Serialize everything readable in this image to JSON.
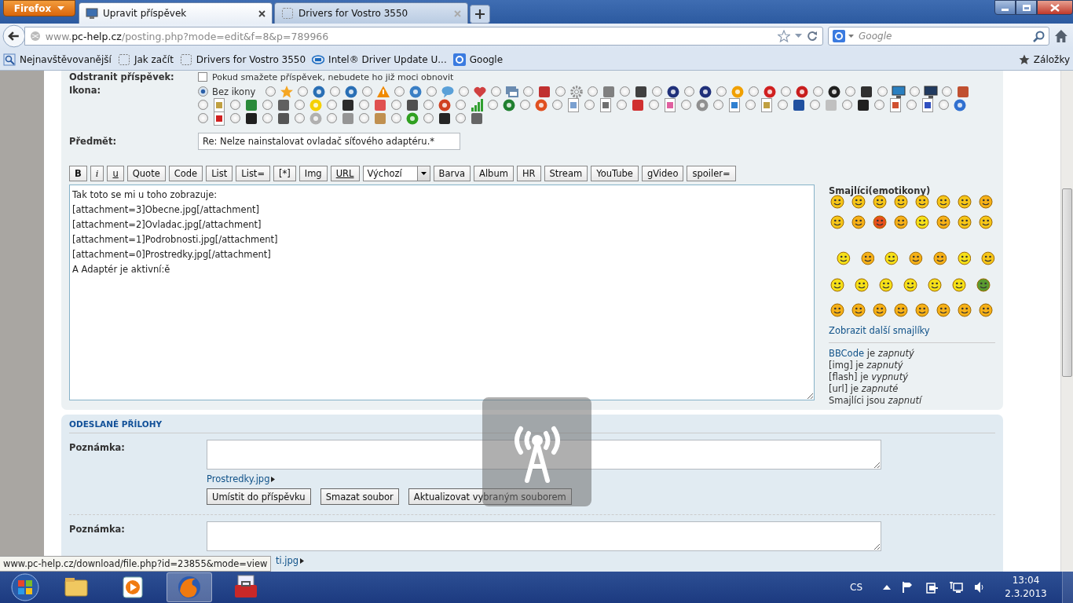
{
  "browser": {
    "firefox_button": "Firefox",
    "tabs": [
      {
        "title": "Upravit příspěvek",
        "selected": true
      },
      {
        "title": "Drivers for Vostro 3550",
        "selected": false
      }
    ],
    "url": {
      "prefix": "www.",
      "domain": "pc-help.cz",
      "path": "/posting.php?mode=edit&f=8&p=789966"
    },
    "search": {
      "placeholder": "Google"
    },
    "bookmarks": [
      {
        "label": "Nejnavštěvovanější",
        "kind": "history"
      },
      {
        "label": "Jak začít",
        "kind": "page"
      },
      {
        "label": "Drivers for Vostro 3550",
        "kind": "page"
      },
      {
        "label": "Intel® Driver Update U...",
        "kind": "oval"
      },
      {
        "label": "Google",
        "kind": "square"
      }
    ],
    "bookmarks_menu": "Záložky"
  },
  "form": {
    "delete_row": {
      "label": "Odstranit příspěvek:",
      "checked": false,
      "note": "Pokud smažete příspěvek, nebudete ho již moci obnovit"
    },
    "icon_field": {
      "label": "Ikona:",
      "options": [
        {
          "selected": true,
          "kind": "none",
          "label": "Bez ikony"
        },
        {
          "selected": false,
          "kind": "star",
          "color": "#f5a623"
        },
        {
          "selected": false,
          "kind": "disc",
          "color": "#2a6fb5"
        },
        {
          "selected": false,
          "kind": "disc",
          "color": "#2a6fb5"
        },
        {
          "selected": false,
          "kind": "warning",
          "color": "#f08a00"
        },
        {
          "selected": false,
          "kind": "disc",
          "color": "#3a7fc5"
        },
        {
          "selected": false,
          "kind": "bubble",
          "color": "#5aa0d8"
        },
        {
          "selected": false,
          "kind": "heart",
          "color": "#d04040"
        },
        {
          "selected": false,
          "kind": "window",
          "color": "#6a8bb0"
        },
        {
          "selected": false,
          "kind": "tile",
          "color": "#c03030"
        },
        {
          "selected": false,
          "kind": "gear",
          "color": "#909090"
        },
        {
          "selected": false,
          "kind": "tile",
          "color": "#808080"
        },
        {
          "selected": false,
          "kind": "tile",
          "color": "#404040"
        },
        {
          "selected": false,
          "kind": "disc",
          "color": "#20307a"
        },
        {
          "selected": false,
          "kind": "disc",
          "color": "#20307a"
        },
        {
          "selected": false,
          "kind": "disc",
          "color": "#f0a000"
        },
        {
          "selected": false,
          "kind": "disc",
          "color": "#d02020"
        },
        {
          "selected": false,
          "kind": "disc",
          "color": "#c81e1e"
        },
        {
          "selected": false,
          "kind": "disc",
          "color": "#202020"
        },
        {
          "selected": false,
          "kind": "tile",
          "color": "#303030"
        },
        {
          "selected": false,
          "kind": "monitor",
          "color": "#2a7fc0"
        },
        {
          "selected": false,
          "kind": "monitor",
          "color": "#203a60"
        },
        {
          "selected": false,
          "kind": "tile",
          "color": "#c05030"
        },
        {
          "selected": false,
          "kind": "doc",
          "color": "#c0a040"
        },
        {
          "selected": false,
          "kind": "tile",
          "color": "#2a8a3a"
        },
        {
          "selected": false,
          "kind": "tile",
          "color": "#606060"
        },
        {
          "selected": false,
          "kind": "disc",
          "color": "#f5d000"
        },
        {
          "selected": false,
          "kind": "tile",
          "color": "#2b2b2b"
        },
        {
          "selected": false,
          "kind": "tile",
          "color": "#e05050"
        },
        {
          "selected": false,
          "kind": "tile",
          "color": "#505050"
        },
        {
          "selected": false,
          "kind": "disc",
          "color": "#d04020"
        },
        {
          "selected": false,
          "kind": "bars",
          "color": "#30a030"
        },
        {
          "selected": false,
          "kind": "disc",
          "color": "#208030"
        },
        {
          "selected": false,
          "kind": "disc",
          "color": "#e05020"
        },
        {
          "selected": false,
          "kind": "doc",
          "color": "#7aa0d0"
        },
        {
          "selected": false,
          "kind": "doc",
          "color": "#707070"
        },
        {
          "selected": false,
          "kind": "tile",
          "color": "#d03030"
        },
        {
          "selected": false,
          "kind": "doc",
          "color": "#e060a0"
        },
        {
          "selected": false,
          "kind": "disc",
          "color": "#909090"
        },
        {
          "selected": false,
          "kind": "doc",
          "color": "#3080d0"
        },
        {
          "selected": false,
          "kind": "doc",
          "color": "#c0a041"
        },
        {
          "selected": false,
          "kind": "tile",
          "color": "#2050a0"
        },
        {
          "selected": false,
          "kind": "tile",
          "color": "#c0c0c0"
        },
        {
          "selected": false,
          "kind": "tile",
          "color": "#202020"
        },
        {
          "selected": false,
          "kind": "doc",
          "color": "#d05030"
        },
        {
          "selected": false,
          "kind": "doc",
          "color": "#3050c0"
        },
        {
          "selected": false,
          "kind": "disc",
          "color": "#3070d0"
        },
        {
          "selected": false,
          "kind": "doc",
          "color": "#d02020"
        },
        {
          "selected": false,
          "kind": "tile",
          "color": "#1f1f1f"
        },
        {
          "selected": false,
          "kind": "tile",
          "color": "#555555"
        },
        {
          "selected": false,
          "kind": "disc",
          "color": "#b0b0b0"
        },
        {
          "selected": false,
          "kind": "tile",
          "color": "#959595"
        },
        {
          "selected": false,
          "kind": "tile",
          "color": "#c09050"
        },
        {
          "selected": false,
          "kind": "disc",
          "color": "#30a020"
        },
        {
          "selected": false,
          "kind": "tile",
          "color": "#252525"
        },
        {
          "selected": false,
          "kind": "tile",
          "color": "#656565"
        }
      ]
    },
    "subject": {
      "label": "Předmět:",
      "value": "Re: Nelze nainstalovat ovladač síťového adaptéru.*"
    }
  },
  "editor": {
    "buttons": [
      {
        "label": "B",
        "kind": "bold"
      },
      {
        "label": "i",
        "kind": "italic"
      },
      {
        "label": "u",
        "kind": "underline"
      },
      {
        "label": "Quote",
        "kind": "plain"
      },
      {
        "label": "Code",
        "kind": "plain"
      },
      {
        "label": "List",
        "kind": "plain"
      },
      {
        "label": "List=",
        "kind": "plain"
      },
      {
        "label": "[*]",
        "kind": "plain"
      },
      {
        "label": "Img",
        "kind": "plain"
      },
      {
        "label": "URL",
        "kind": "link"
      },
      {
        "label": "Výchozí",
        "kind": "select"
      },
      {
        "label": "Barva",
        "kind": "plain"
      },
      {
        "label": "Album",
        "kind": "plain"
      },
      {
        "label": "HR",
        "kind": "plain"
      },
      {
        "label": "Stream",
        "kind": "plain"
      },
      {
        "label": "YouTube",
        "kind": "plain"
      },
      {
        "label": "gVideo",
        "kind": "plain"
      },
      {
        "label": "spoiler=",
        "kind": "plain"
      }
    ],
    "lines": [
      "Tak toto se mi u toho zobrazuje:",
      "[attachment=3]Obecne.jpg[/attachment]",
      "[attachment=2]Ovladac.jpg[/attachment]",
      "[attachment=1]Podrobnosti.jpg[/attachment]",
      "[attachment=0]Prostredky.jpg[/attachment]",
      "A Adaptér je aktivní:ě"
    ],
    "smileys_title": "Smajlíci(emotikony)",
    "smiley_rows": [
      [
        {
          "color": "#f5c518"
        },
        {
          "color": "#f5c518"
        },
        {
          "color": "#f5c518"
        },
        {
          "color": "#f5c518"
        },
        {
          "color": "#f5c518"
        },
        {
          "color": "#f5c518"
        },
        {
          "color": "#f5c518"
        },
        {
          "color": "#f5b018"
        }
      ],
      [
        {
          "color": "#f5c518"
        },
        {
          "color": "#f5b018"
        },
        {
          "color": "#e8501c"
        },
        {
          "color": "#f5b018"
        },
        {
          "color": "#f5e018"
        },
        {
          "color": "#f5b018"
        },
        {
          "color": "#f5c518"
        },
        {
          "color": "#f5c518"
        }
      ],
      [
        {
          "color": "#f5e018"
        },
        {
          "color": "#f5b018"
        },
        {
          "color": "#f5e018"
        },
        {
          "color": "#f5b018"
        },
        {
          "color": "#f5b018"
        },
        {
          "color": "#f5e018"
        },
        {
          "color": "#f5c518"
        }
      ],
      [
        {
          "color": "#f5e018"
        },
        {
          "color": "#f5e018"
        },
        {
          "color": "#f5e018"
        },
        {
          "color": "#f5e018"
        },
        {
          "color": "#f5e018"
        },
        {
          "color": "#f5e018"
        },
        {
          "color": "#5a9a30"
        }
      ],
      [
        {
          "color": "#f5b018"
        },
        {
          "color": "#f5b018"
        },
        {
          "color": "#f5b018"
        },
        {
          "color": "#f5b018"
        },
        {
          "color": "#f5b018"
        },
        {
          "color": "#f5b018"
        },
        {
          "color": "#f5b018"
        },
        {
          "color": "#f5b018"
        }
      ]
    ],
    "more_smileys": "Zobrazit další smajlíky",
    "status": [
      {
        "link": "BBCode",
        "text": " je *zapnutý*"
      },
      {
        "text": "[img] je *zapnutý*"
      },
      {
        "text": "[flash] je *vypnutý*"
      },
      {
        "text": "[url] je *zapnuté*"
      },
      {
        "text": "Smajlíci jsou *zapnutí*"
      }
    ]
  },
  "attachments": {
    "title": "ODESLANÉ PŘÍLOHY",
    "items": [
      {
        "label": "Poznámka:",
        "file": "Prostredky.jpg",
        "buttons": [
          "Umístit do příspěvku",
          "Smazat soubor",
          "Aktualizovat vybraným souborem"
        ]
      },
      {
        "label": "Poznámka:",
        "file": "ti.jpg"
      }
    ]
  },
  "status_url": "www.pc-help.cz/download/file.php?id=23855&mode=view",
  "taskbar": {
    "apps": [
      {
        "kind": "folder",
        "active": false
      },
      {
        "kind": "media",
        "active": false
      },
      {
        "kind": "browser",
        "active": true
      },
      {
        "kind": "toolbox",
        "active": false
      }
    ],
    "language": "CS",
    "time": "13:04",
    "date": "2.3.2013"
  }
}
